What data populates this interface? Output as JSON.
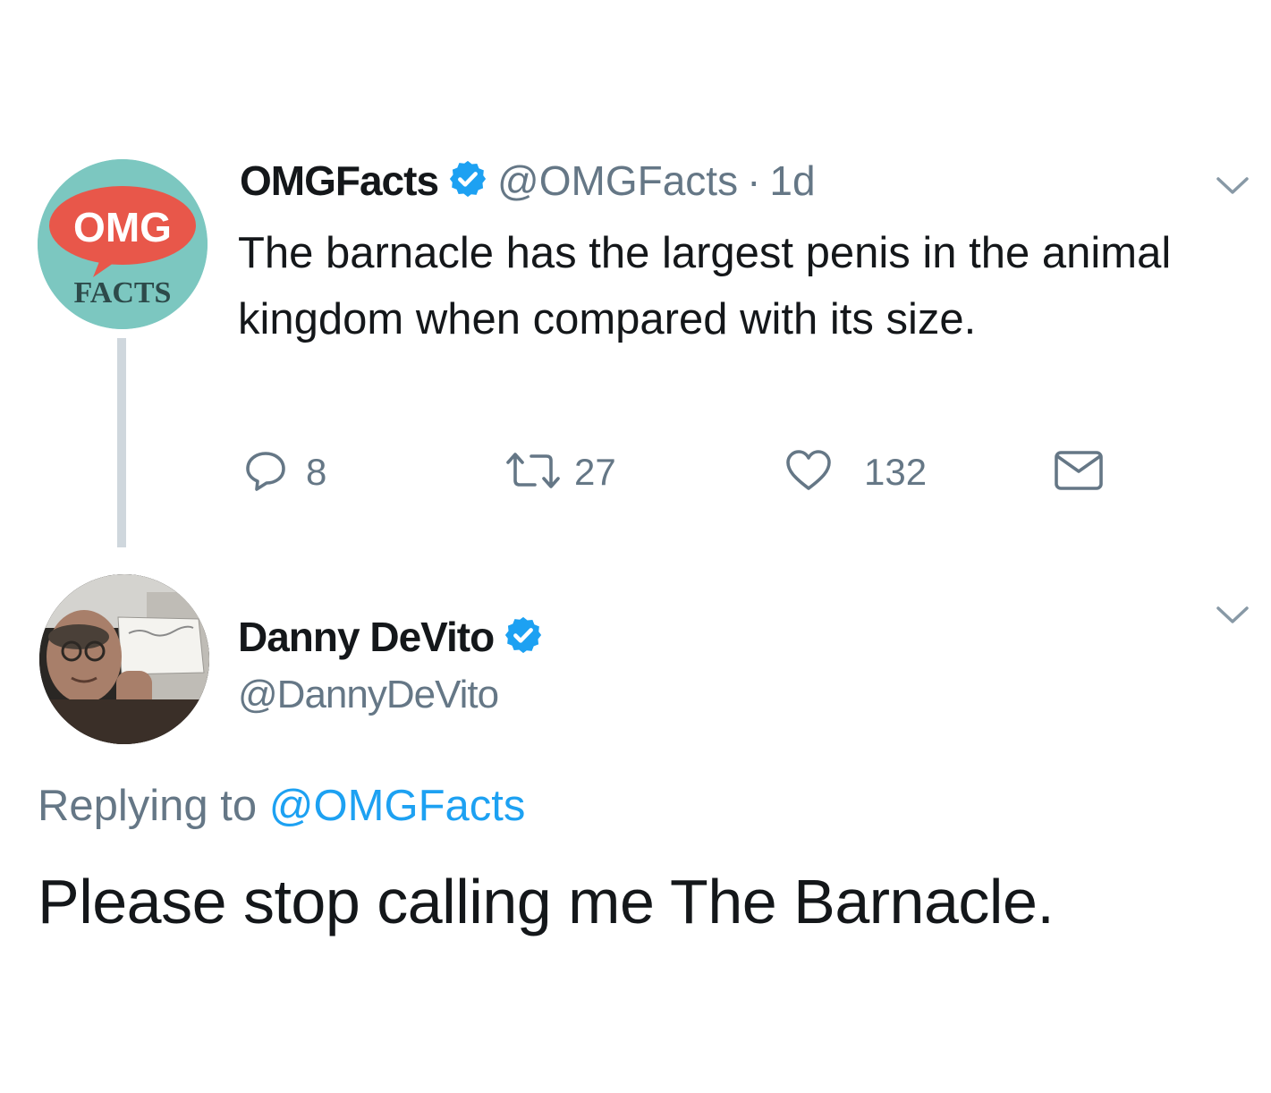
{
  "tweet1": {
    "avatar": {
      "icon": "omgfacts-logo",
      "line1": "OMG",
      "line2": "FACTS"
    },
    "display_name": "OMGFacts",
    "verified": true,
    "handle": "@OMGFacts",
    "separator": "·",
    "timestamp": "1d",
    "text": "The barnacle has the largest penis in the animal kingdom when compared with its size.",
    "actions": {
      "reply_count": "8",
      "retweet_count": "27",
      "like_count": "132"
    }
  },
  "tweet2": {
    "display_name": "Danny DeVito",
    "verified": true,
    "handle": "@DannyDeVito",
    "replying_prefix": "Replying to",
    "replying_handle": "@OMGFacts",
    "text": "Please stop calling me The Barnacle."
  },
  "colors": {
    "verified_blue": "#1da1f2",
    "secondary_text": "#657786",
    "thread_line": "#cfd7dd",
    "omg_teal": "#7cc7c0",
    "omg_red": "#e8574a"
  }
}
